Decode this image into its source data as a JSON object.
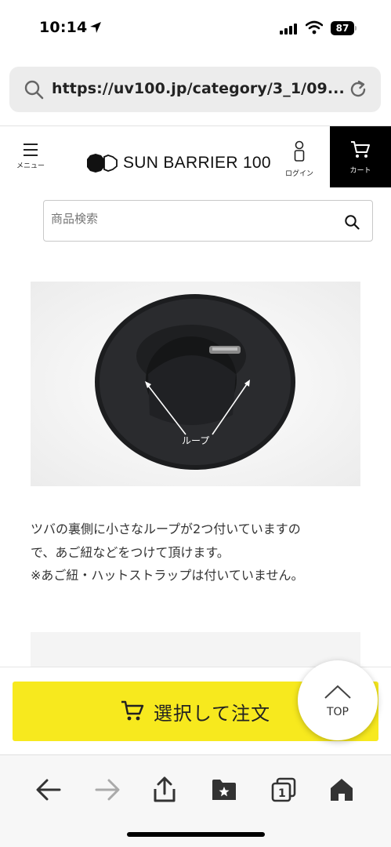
{
  "status_bar": {
    "time": "10:14",
    "battery": "87"
  },
  "browser": {
    "url": "https://uv100.jp/category/3_1/09..."
  },
  "header": {
    "menu_label": "メニュー",
    "logo_text": "SUN BARRIER 100",
    "login_label": "ログイン",
    "cart_label": "カート"
  },
  "search": {
    "placeholder": "商品検索"
  },
  "photo": {
    "annotation": "ループ"
  },
  "description": {
    "line1": "ツバの裏側に小さなループが2つ付いていますの",
    "line2": "で、あご紐などをつけて頂けます。",
    "line3": "※あご紐・ハットストラップは付いていません。"
  },
  "order": {
    "button_label": "選択して注文",
    "top_label": "TOP",
    "button_color": "#f7e91e"
  },
  "toolbar": {
    "tab_count": "1"
  }
}
